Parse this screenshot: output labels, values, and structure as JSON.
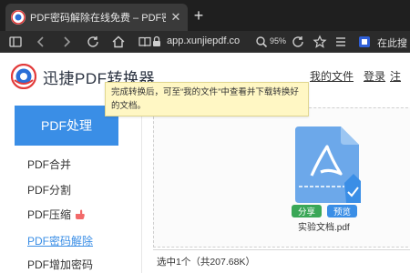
{
  "browser": {
    "tab_title": "PDF密码解除在线免费 – PDF密码移除",
    "tab_close": "✕",
    "new_tab": "+",
    "url": "app.xunjiepdf.co",
    "zoom": "95%",
    "search_text": "在此搜"
  },
  "header": {
    "brand": "迅捷PDF转换器",
    "nav": {
      "my_files": "我的文件",
      "login": "登录",
      "register": "注"
    }
  },
  "tooltip": {
    "text": "完成转换后，可至“我的文件”中查看并下载转换好的文档。"
  },
  "sidebar": {
    "header": "PDF处理",
    "items": [
      {
        "label": "PDF合并"
      },
      {
        "label": "PDF分割"
      },
      {
        "label": "PDF压缩"
      },
      {
        "label": "PDF密码解除"
      },
      {
        "label": "PDF增加密码"
      }
    ]
  },
  "file": {
    "share_label": "分享",
    "preview_label": "预览",
    "name": "实验文档.pdf"
  },
  "status": {
    "text": "选中1个（共207.68K）"
  },
  "colors": {
    "accent_blue": "#3a8ee6",
    "share_green": "#3aa757",
    "tooltip_bg": "#fff7c4",
    "browser_dark": "#1f1f1f"
  }
}
